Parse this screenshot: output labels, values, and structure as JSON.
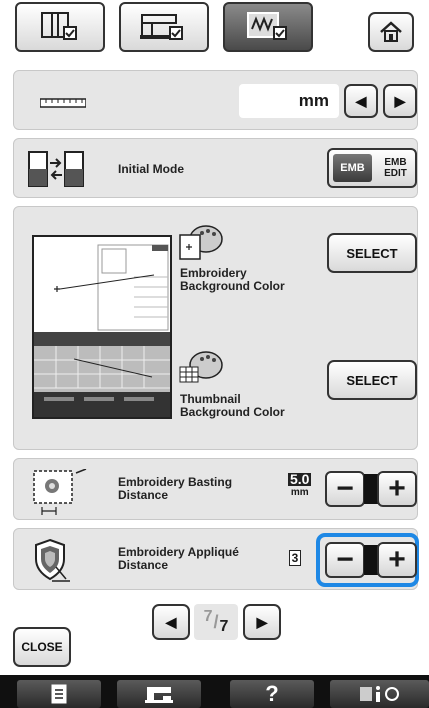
{
  "tabs": [
    {
      "icon": "page-setting-icon"
    },
    {
      "icon": "sewing-setting-icon"
    },
    {
      "icon": "embroidery-setting-icon"
    }
  ],
  "home_icon": "home-icon",
  "unit_row": {
    "value": "mm",
    "left_arrow": "◀",
    "right_arrow": "▶"
  },
  "initial_mode": {
    "label": "Initial Mode",
    "emb_label": "EMB",
    "emb_edit_label_1": "EMB",
    "emb_edit_label_2": "EDIT"
  },
  "colors_panel": {
    "embroidery_bg_label_1": "Embroidery",
    "embroidery_bg_label_2": "Background Color",
    "thumbnail_bg_label_1": "Thumbnail",
    "thumbnail_bg_label_2": "Background Color",
    "select_label": "SELECT"
  },
  "basting": {
    "label_1": "Embroidery Basting",
    "label_2": "Distance",
    "value": "5.0",
    "unit": "mm",
    "minus": "−",
    "plus": "+"
  },
  "applique": {
    "label_1": "Embroidery Appliqué",
    "label_2": "Distance",
    "value": "3",
    "minus": "−",
    "plus": "+"
  },
  "pager": {
    "prev": "◀",
    "current": "7",
    "total": "7",
    "next": "▶"
  },
  "close_label": "CLOSE",
  "bottom_bar": {
    "help": "?"
  },
  "colors": {
    "highlight_blue": "#1e88e5",
    "panel_gray": "#e6e6e6"
  }
}
